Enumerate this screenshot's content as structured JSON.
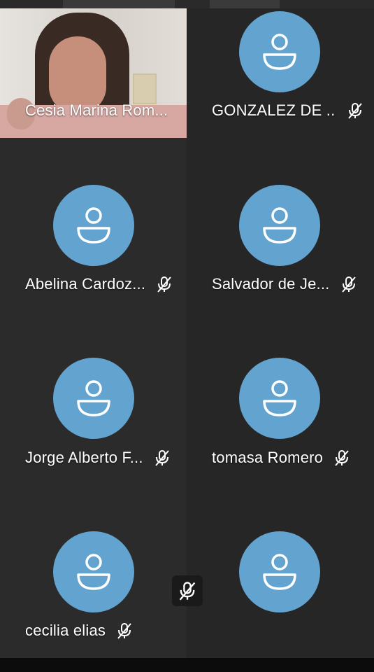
{
  "app": {
    "accent_avatar_color": "#62a3cf",
    "tile_bg": "#2b2b2b"
  },
  "participants": [
    {
      "name": "Cesia Marina Rom...",
      "muted": false,
      "has_video": true
    },
    {
      "name": "GONZALEZ DE ...",
      "muted": true,
      "has_video": false
    },
    {
      "name": "Abelina Cardoz...",
      "muted": true,
      "has_video": false
    },
    {
      "name": "Salvador de Je...",
      "muted": true,
      "has_video": false
    },
    {
      "name": "Jorge Alberto F...",
      "muted": true,
      "has_video": false
    },
    {
      "name": "tomasa Romero",
      "muted": true,
      "has_video": false
    },
    {
      "name": "cecilia elias",
      "muted": true,
      "has_video": false
    },
    {
      "name": "",
      "muted": false,
      "has_video": false
    }
  ],
  "icons": {
    "avatar": "user-icon",
    "mute": "mic-off-icon",
    "self_mute": "mic-off-icon"
  }
}
